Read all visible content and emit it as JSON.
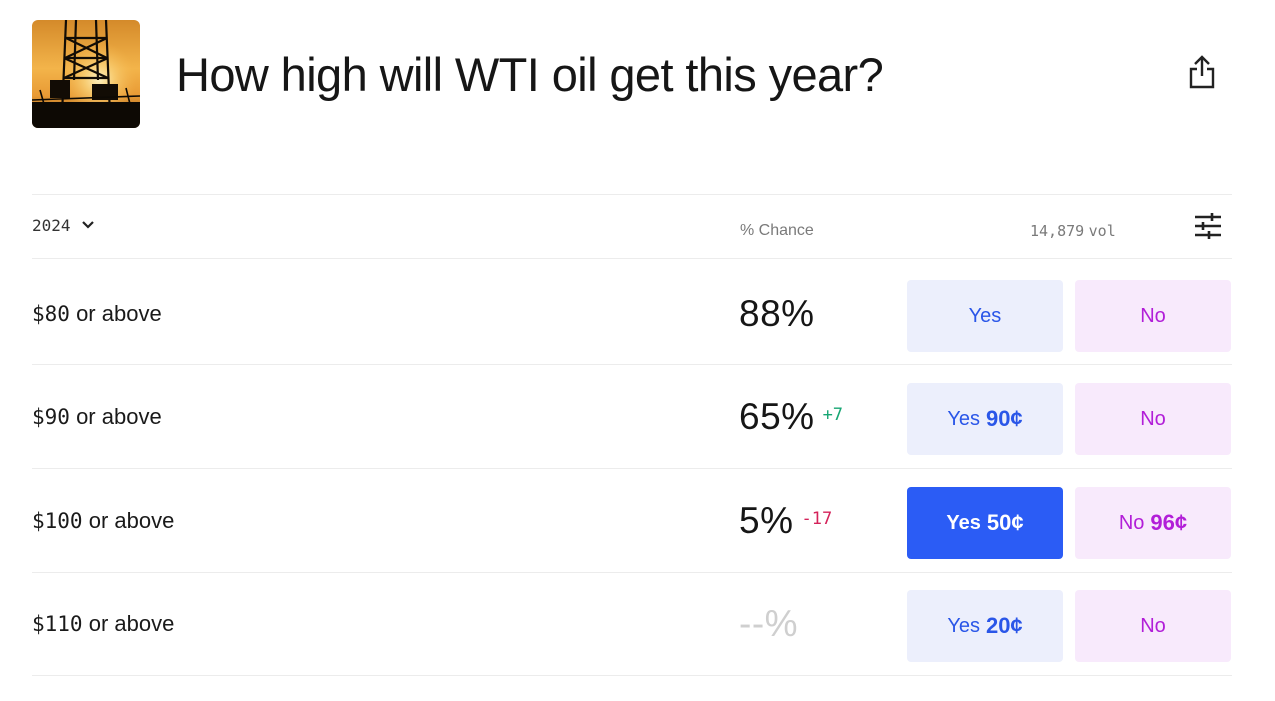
{
  "page": {
    "title": "How high will WTI oil get this year?"
  },
  "icons": {
    "hero": "oil-rig-sunset-image",
    "share": "share-icon",
    "year_chevron": "chevron-down-icon",
    "filter": "sliders-icon"
  },
  "table_header": {
    "year": "2024",
    "chance_label": "% Chance",
    "volume_value": "14,879",
    "volume_unit": "vol"
  },
  "markets": [
    {
      "amount": "$80",
      "suffix": "or above",
      "chance": "88%",
      "delta": "",
      "yes_label": "Yes",
      "yes_price": "",
      "no_label": "No",
      "no_price": ""
    },
    {
      "amount": "$90",
      "suffix": "or above",
      "chance": "65%",
      "delta": "+7",
      "yes_label": "Yes",
      "yes_price": "90¢",
      "no_label": "No",
      "no_price": ""
    },
    {
      "amount": "$100",
      "suffix": "or above",
      "chance": "5%",
      "delta": "-17",
      "yes_label": "Yes",
      "yes_price": "50¢",
      "no_label": "No",
      "no_price": "96¢"
    },
    {
      "amount": "$110",
      "suffix": "or above",
      "chance": "--%",
      "delta": "",
      "yes_label": "Yes",
      "yes_price": "20¢",
      "no_label": "No",
      "no_price": ""
    }
  ],
  "colors": {
    "yes_accent": "#2a56e8",
    "yes_active_bg": "#2b5cf5",
    "no_accent": "#b21ed8",
    "delta_up": "#17a673",
    "delta_down": "#d4235a"
  }
}
